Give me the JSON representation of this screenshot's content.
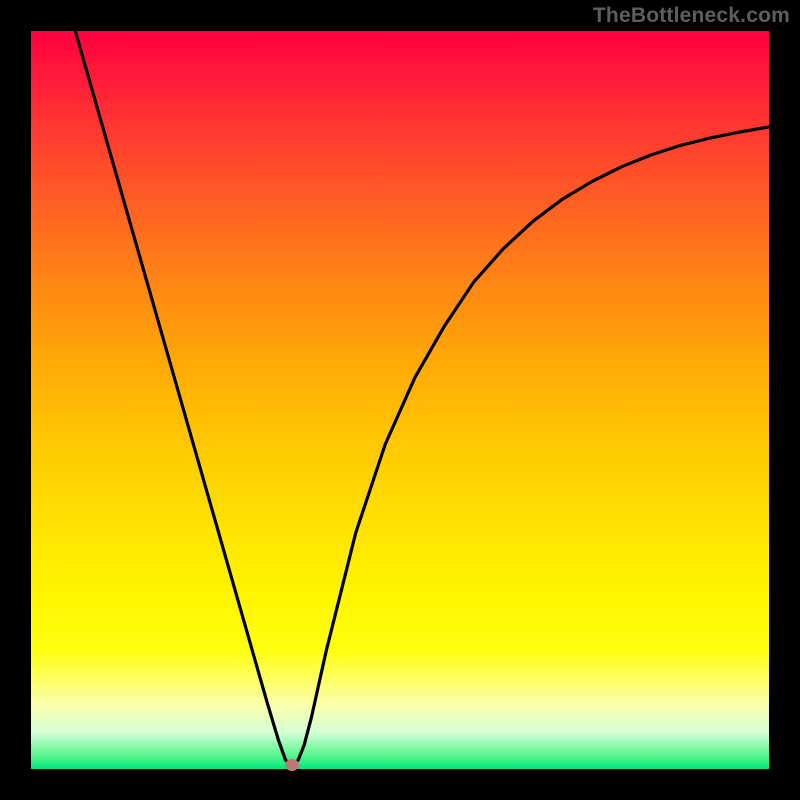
{
  "watermark": "TheBottleneck.com",
  "colors": {
    "frame": "#000000",
    "curve": "#000000",
    "marker": "#bd7a73"
  },
  "chart_data": {
    "type": "line",
    "title": "",
    "xlabel": "",
    "ylabel": "",
    "xlim": [
      0,
      100
    ],
    "ylim": [
      0,
      100
    ],
    "grid": false,
    "series": [
      {
        "name": "bottleneck-curve",
        "x": [
          6,
          10,
          14,
          18,
          22,
          26,
          30,
          32,
          33.5,
          34.5,
          35.3,
          36.2,
          37,
          38,
          40,
          44,
          48,
          52,
          56,
          60,
          64,
          68,
          72,
          76,
          80,
          84,
          88,
          92,
          96,
          100
        ],
        "y": [
          100,
          86,
          72,
          58,
          44,
          30,
          16,
          9,
          4,
          1.2,
          0.5,
          1.2,
          3.2,
          7,
          16,
          32,
          44,
          53,
          60,
          66,
          70.5,
          74.2,
          77.2,
          79.6,
          81.6,
          83.2,
          84.5,
          85.5,
          86.3,
          87
        ]
      }
    ],
    "marker": {
      "x": 35.3,
      "y": 0.5
    }
  }
}
